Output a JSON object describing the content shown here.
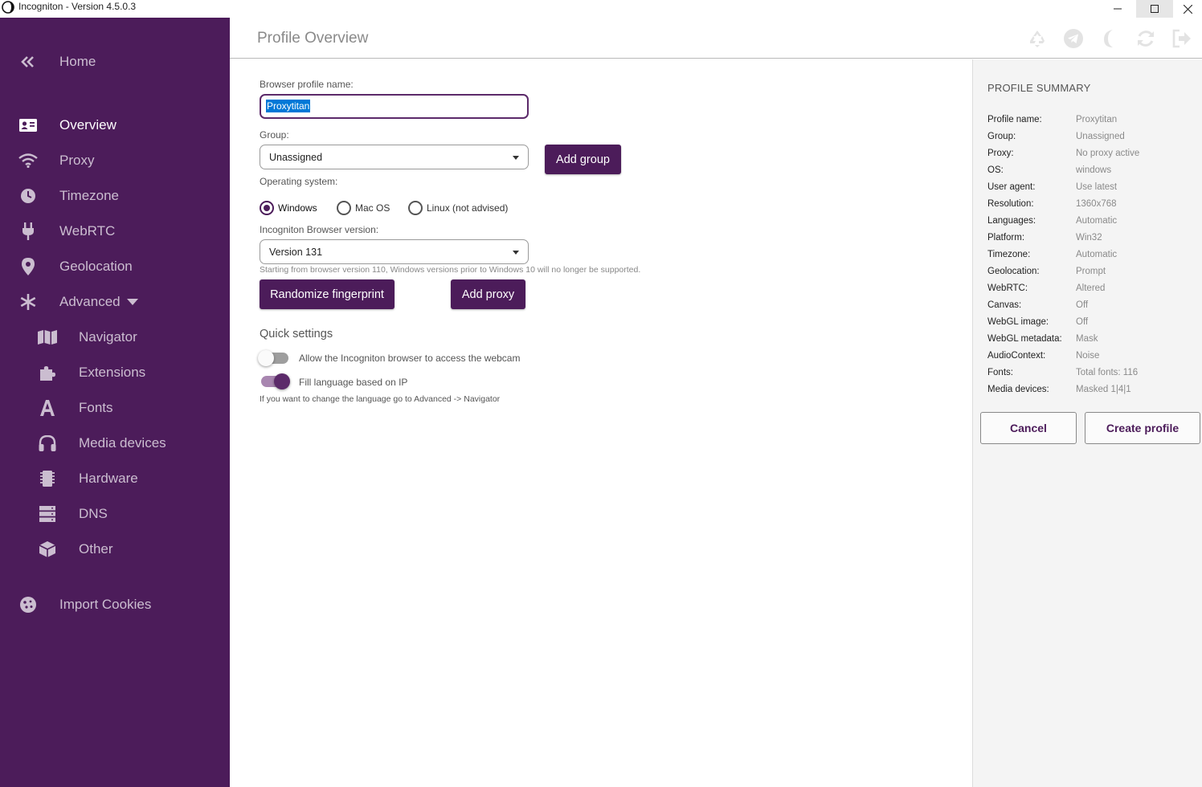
{
  "window": {
    "title": "Incogniton - Version 4.5.0.3"
  },
  "sidebar": {
    "home": "Home",
    "items": [
      {
        "label": "Overview",
        "icon": "id-card-icon"
      },
      {
        "label": "Proxy",
        "icon": "wifi-icon"
      },
      {
        "label": "Timezone",
        "icon": "clock-icon"
      },
      {
        "label": "WebRTC",
        "icon": "plug-icon"
      },
      {
        "label": "Geolocation",
        "icon": "map-pin-icon"
      },
      {
        "label": "Advanced",
        "icon": "asterisk-icon"
      }
    ],
    "sub_items": [
      {
        "label": "Navigator",
        "icon": "map-icon"
      },
      {
        "label": "Extensions",
        "icon": "puzzle-icon"
      },
      {
        "label": "Fonts",
        "icon": "font-icon"
      },
      {
        "label": "Media devices",
        "icon": "headphones-icon"
      },
      {
        "label": "Hardware",
        "icon": "chip-icon"
      },
      {
        "label": "DNS",
        "icon": "server-icon"
      },
      {
        "label": "Other",
        "icon": "cube-icon"
      }
    ],
    "import_cookies": "Import Cookies"
  },
  "header": {
    "title": "Profile Overview"
  },
  "form": {
    "profile_name_label": "Browser profile name:",
    "profile_name_value": "Proxytitan",
    "group_label": "Group:",
    "group_value": "Unassigned",
    "add_group": "Add group",
    "os_label": "Operating system:",
    "os_options": [
      "Windows",
      "Mac OS",
      "Linux (not advised)"
    ],
    "os_selected": "Windows",
    "browser_version_label": "Incogniton Browser version:",
    "browser_version_value": "Version 131",
    "version_note": "Starting from browser version 110, Windows versions prior to Windows 10 will no longer be supported.",
    "randomize_button": "Randomize fingerprint",
    "add_proxy_button": "Add proxy",
    "quick_settings_title": "Quick settings",
    "webcam_toggle_label": "Allow the Incogniton browser to access the webcam",
    "webcam_toggle_on": false,
    "language_toggle_label": "Fill language based on IP",
    "language_toggle_on": true,
    "language_note": "If you want to change the language go to Advanced -> Navigator"
  },
  "summary": {
    "title": "PROFILE SUMMARY",
    "rows": [
      {
        "key": "Profile name:",
        "value": "Proxytitan"
      },
      {
        "key": "Group:",
        "value": "Unassigned"
      },
      {
        "key": "Proxy:",
        "value": "No proxy active"
      },
      {
        "key": "OS:",
        "value": "windows"
      },
      {
        "key": "User agent:",
        "value": "Use latest"
      },
      {
        "key": "Resolution:",
        "value": "1360x768"
      },
      {
        "key": "Languages:",
        "value": "Automatic"
      },
      {
        "key": "Platform:",
        "value": "Win32"
      },
      {
        "key": "Timezone:",
        "value": "Automatic"
      },
      {
        "key": "Geolocation:",
        "value": "Prompt"
      },
      {
        "key": "WebRTC:",
        "value": "Altered"
      },
      {
        "key": "Canvas:",
        "value": "Off"
      },
      {
        "key": "WebGL image:",
        "value": "Off"
      },
      {
        "key": "WebGL metadata:",
        "value": "Mask"
      },
      {
        "key": "AudioContext:",
        "value": "Noise"
      },
      {
        "key": "Fonts:",
        "value": "Total fonts: 116"
      },
      {
        "key": "Media devices:",
        "value": "Masked 1|4|1"
      }
    ],
    "cancel": "Cancel",
    "create": "Create profile"
  },
  "colors": {
    "brand": "#4c1c5a",
    "sidebar_text": "#cbbdd0",
    "selection": "#0078d7"
  }
}
